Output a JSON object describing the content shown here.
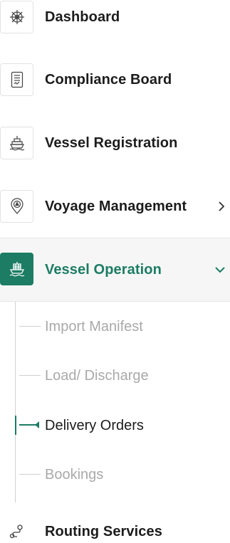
{
  "colors": {
    "accent": "#1c7c64",
    "text_primary": "#1c1c1c",
    "text_muted": "#a9a9a9",
    "active_bg": "#f5f6f5"
  },
  "nav": {
    "items": [
      {
        "label": "Dashboard",
        "icon": "ship-wheel-icon"
      },
      {
        "label": "Compliance Board",
        "icon": "document-icon"
      },
      {
        "label": "Vessel Registration",
        "icon": "ship-icon"
      },
      {
        "label": "Voyage Management",
        "icon": "location-pin-icon",
        "chevron": "chevron-right-icon"
      },
      {
        "label": "Vessel Operation",
        "icon": "cargo-ship-icon",
        "chevron": "chevron-down-icon",
        "active": true
      },
      {
        "label": "Routing Services",
        "icon": "route-icon"
      }
    ],
    "submenu": {
      "items": [
        {
          "label": "Import Manifest"
        },
        {
          "label": "Load/ Discharge"
        },
        {
          "label": "Delivery Orders",
          "current": true
        },
        {
          "label": "Bookings"
        }
      ]
    }
  }
}
